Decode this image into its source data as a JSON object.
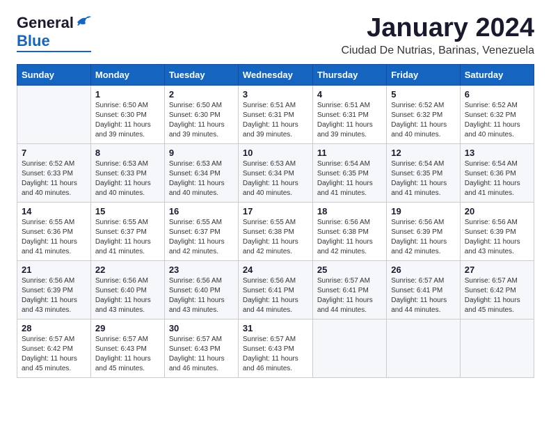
{
  "header": {
    "logo": {
      "general": "General",
      "blue": "Blue",
      "bird_unicode": "🐦"
    },
    "title": "January 2024",
    "location": "Ciudad De Nutrias, Barinas, Venezuela"
  },
  "calendar": {
    "days_of_week": [
      "Sunday",
      "Monday",
      "Tuesday",
      "Wednesday",
      "Thursday",
      "Friday",
      "Saturday"
    ],
    "weeks": [
      [
        {
          "day": "",
          "info": ""
        },
        {
          "day": "1",
          "info": "Sunrise: 6:50 AM\nSunset: 6:30 PM\nDaylight: 11 hours\nand 39 minutes."
        },
        {
          "day": "2",
          "info": "Sunrise: 6:50 AM\nSunset: 6:30 PM\nDaylight: 11 hours\nand 39 minutes."
        },
        {
          "day": "3",
          "info": "Sunrise: 6:51 AM\nSunset: 6:31 PM\nDaylight: 11 hours\nand 39 minutes."
        },
        {
          "day": "4",
          "info": "Sunrise: 6:51 AM\nSunset: 6:31 PM\nDaylight: 11 hours\nand 39 minutes."
        },
        {
          "day": "5",
          "info": "Sunrise: 6:52 AM\nSunset: 6:32 PM\nDaylight: 11 hours\nand 40 minutes."
        },
        {
          "day": "6",
          "info": "Sunrise: 6:52 AM\nSunset: 6:32 PM\nDaylight: 11 hours\nand 40 minutes."
        }
      ],
      [
        {
          "day": "7",
          "info": "Sunrise: 6:52 AM\nSunset: 6:33 PM\nDaylight: 11 hours\nand 40 minutes."
        },
        {
          "day": "8",
          "info": "Sunrise: 6:53 AM\nSunset: 6:33 PM\nDaylight: 11 hours\nand 40 minutes."
        },
        {
          "day": "9",
          "info": "Sunrise: 6:53 AM\nSunset: 6:34 PM\nDaylight: 11 hours\nand 40 minutes."
        },
        {
          "day": "10",
          "info": "Sunrise: 6:53 AM\nSunset: 6:34 PM\nDaylight: 11 hours\nand 40 minutes."
        },
        {
          "day": "11",
          "info": "Sunrise: 6:54 AM\nSunset: 6:35 PM\nDaylight: 11 hours\nand 41 minutes."
        },
        {
          "day": "12",
          "info": "Sunrise: 6:54 AM\nSunset: 6:35 PM\nDaylight: 11 hours\nand 41 minutes."
        },
        {
          "day": "13",
          "info": "Sunrise: 6:54 AM\nSunset: 6:36 PM\nDaylight: 11 hours\nand 41 minutes."
        }
      ],
      [
        {
          "day": "14",
          "info": "Sunrise: 6:55 AM\nSunset: 6:36 PM\nDaylight: 11 hours\nand 41 minutes."
        },
        {
          "day": "15",
          "info": "Sunrise: 6:55 AM\nSunset: 6:37 PM\nDaylight: 11 hours\nand 41 minutes."
        },
        {
          "day": "16",
          "info": "Sunrise: 6:55 AM\nSunset: 6:37 PM\nDaylight: 11 hours\nand 42 minutes."
        },
        {
          "day": "17",
          "info": "Sunrise: 6:55 AM\nSunset: 6:38 PM\nDaylight: 11 hours\nand 42 minutes."
        },
        {
          "day": "18",
          "info": "Sunrise: 6:56 AM\nSunset: 6:38 PM\nDaylight: 11 hours\nand 42 minutes."
        },
        {
          "day": "19",
          "info": "Sunrise: 6:56 AM\nSunset: 6:39 PM\nDaylight: 11 hours\nand 42 minutes."
        },
        {
          "day": "20",
          "info": "Sunrise: 6:56 AM\nSunset: 6:39 PM\nDaylight: 11 hours\nand 43 minutes."
        }
      ],
      [
        {
          "day": "21",
          "info": "Sunrise: 6:56 AM\nSunset: 6:39 PM\nDaylight: 11 hours\nand 43 minutes."
        },
        {
          "day": "22",
          "info": "Sunrise: 6:56 AM\nSunset: 6:40 PM\nDaylight: 11 hours\nand 43 minutes."
        },
        {
          "day": "23",
          "info": "Sunrise: 6:56 AM\nSunset: 6:40 PM\nDaylight: 11 hours\nand 43 minutes."
        },
        {
          "day": "24",
          "info": "Sunrise: 6:56 AM\nSunset: 6:41 PM\nDaylight: 11 hours\nand 44 minutes."
        },
        {
          "day": "25",
          "info": "Sunrise: 6:57 AM\nSunset: 6:41 PM\nDaylight: 11 hours\nand 44 minutes."
        },
        {
          "day": "26",
          "info": "Sunrise: 6:57 AM\nSunset: 6:41 PM\nDaylight: 11 hours\nand 44 minutes."
        },
        {
          "day": "27",
          "info": "Sunrise: 6:57 AM\nSunset: 6:42 PM\nDaylight: 11 hours\nand 45 minutes."
        }
      ],
      [
        {
          "day": "28",
          "info": "Sunrise: 6:57 AM\nSunset: 6:42 PM\nDaylight: 11 hours\nand 45 minutes."
        },
        {
          "day": "29",
          "info": "Sunrise: 6:57 AM\nSunset: 6:43 PM\nDaylight: 11 hours\nand 45 minutes."
        },
        {
          "day": "30",
          "info": "Sunrise: 6:57 AM\nSunset: 6:43 PM\nDaylight: 11 hours\nand 46 minutes."
        },
        {
          "day": "31",
          "info": "Sunrise: 6:57 AM\nSunset: 6:43 PM\nDaylight: 11 hours\nand 46 minutes."
        },
        {
          "day": "",
          "info": ""
        },
        {
          "day": "",
          "info": ""
        },
        {
          "day": "",
          "info": ""
        }
      ]
    ]
  }
}
